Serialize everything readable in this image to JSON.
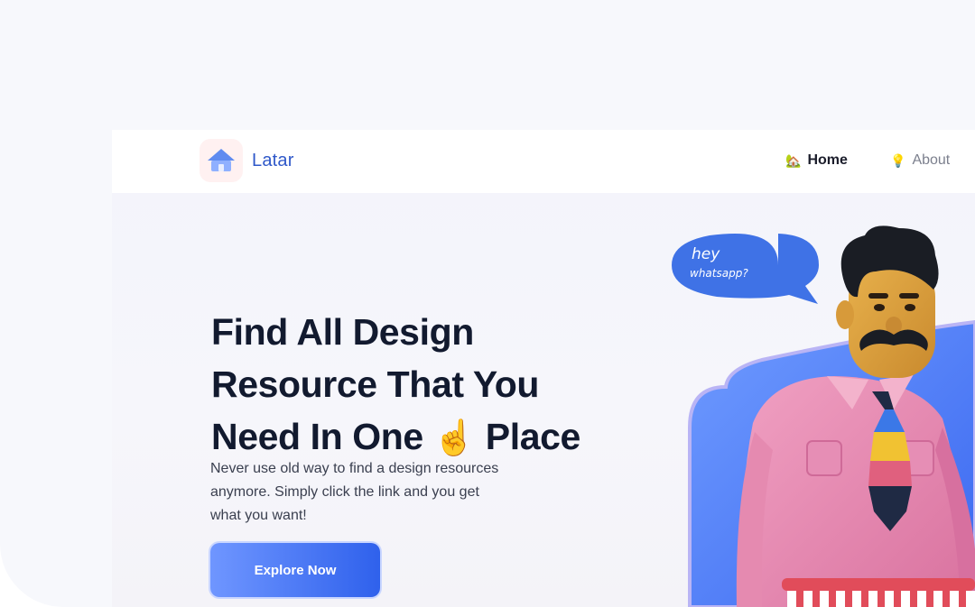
{
  "navbar": {
    "brand": "Latar",
    "items": [
      {
        "label": "Home",
        "icon": "house-icon",
        "active": true
      },
      {
        "label": "About",
        "icon": "lightbulb-icon",
        "active": false
      }
    ]
  },
  "hero": {
    "headline_lines": [
      "Find All Design",
      "Resource That You",
      "Need In One",
      "Place"
    ],
    "headline_emoji": "☝️",
    "subtext": "Never use old way to find a design resources anymore. Simply click the link and you get what you want!",
    "cta_label": "Explore Now"
  },
  "speech_bubble": {
    "line1": "hey",
    "line2": "whatsapp?"
  },
  "colors": {
    "brand": "#2f58c9",
    "heading": "#121a2f",
    "cta_start": "#6f96ff",
    "cta_end": "#2f61ec",
    "bubble": "#3f72e6",
    "shirt": "#e58ab0"
  }
}
